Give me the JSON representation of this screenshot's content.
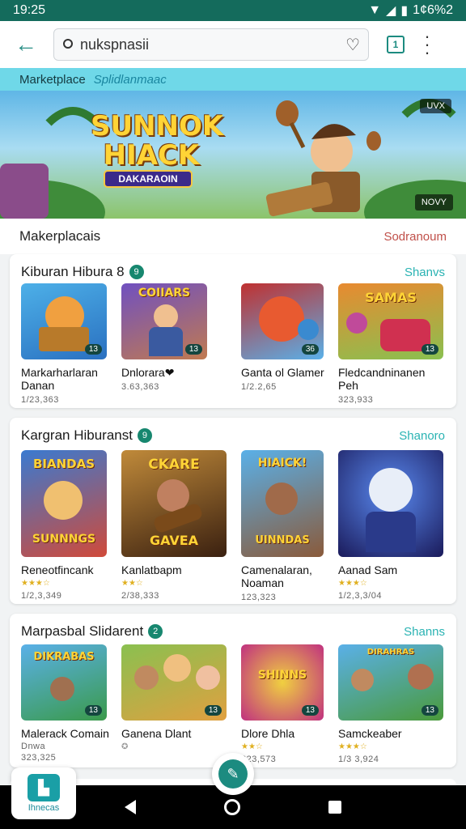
{
  "status_bar": {
    "time": "19:25",
    "battery": "1¢6%2"
  },
  "search": {
    "value": "nuksрnasii",
    "placeholder": ""
  },
  "sub_tabs": {
    "active": "Marketplace",
    "inactive": "Splidlanmaac"
  },
  "hero": {
    "title_line1": "SUNNOK",
    "title_line2": "HIACK",
    "badge": "DAKARAOIN",
    "tag_top": "UVX",
    "tag_bottom": "NOVY"
  },
  "market": {
    "title": "Makerplacais",
    "link": "Sodranoum"
  },
  "sections": [
    {
      "title": "Kiburan  Hibura 8",
      "badge": "9",
      "more": "Shanvs",
      "cards": [
        {
          "title": "Markarharlaran Danan",
          "meta": "1/23,363",
          "num": "13",
          "stars": ""
        },
        {
          "title": "Dnlorara❤",
          "meta": "3.63,363",
          "num": "13",
          "stars": ""
        },
        {
          "title": "Ganta ol Glamer",
          "meta": "1/2.2,65",
          "num": "36",
          "stars": ""
        },
        {
          "title": "Fledcandninanen Peh",
          "meta": "323,933",
          "num": "13",
          "stars": ""
        }
      ]
    },
    {
      "title": "Kargran Hiburanst",
      "badge": "9",
      "more": "Shanoro",
      "cards": [
        {
          "title": "Reneotfincank",
          "meta": "1/2,3,349",
          "num": "",
          "stars": "★★★☆"
        },
        {
          "title": "Kanlatbapm",
          "meta": "2/38,333",
          "num": "",
          "stars": "★★☆"
        },
        {
          "title": "Camenalaran, Noaman",
          "meta": "123,323",
          "num": "",
          "stars": ""
        },
        {
          "title": "Aanad Sam",
          "meta": "1/2,3,3/04",
          "num": "",
          "stars": "★★★☆"
        }
      ],
      "art_labels": [
        "BIANDAS",
        "CKARE",
        "HIAICK!",
        ""
      ],
      "art_labels_bottom": [
        "SUNNNGS",
        "GAVEA",
        "UINNDAS",
        ""
      ]
    },
    {
      "title": "Marpasbal Slidarent",
      "badge": "2",
      "more": "Shanns",
      "cards": [
        {
          "title": "Malerack Comain",
          "meta": "323,325",
          "num": "13",
          "stars": "",
          "sub": "Dnwa"
        },
        {
          "title": "Ganena Dlant",
          "meta": "",
          "num": "13",
          "stars": "✪",
          "sub": ""
        },
        {
          "title": "Dlore Dhla",
          "meta": "223,573",
          "num": "13",
          "stars": "★★☆",
          "sub": ""
        },
        {
          "title": "Samckeaber",
          "meta": "1/3 3,924",
          "num": "13",
          "stars": "★★★☆",
          "sub": ""
        }
      ],
      "art_labels": [
        "DIKRABAS",
        "",
        "SHINNS",
        "DIRAHRAS"
      ]
    }
  ],
  "card_art_top": [
    "COIIARS",
    "SAMAS"
  ],
  "bottom_app": {
    "label": "Ihnecas"
  },
  "colors": {
    "status": "#146b5c",
    "accent": "#1c8b80",
    "tab_strip": "#6fd8e8",
    "link_red": "#c0504a"
  }
}
